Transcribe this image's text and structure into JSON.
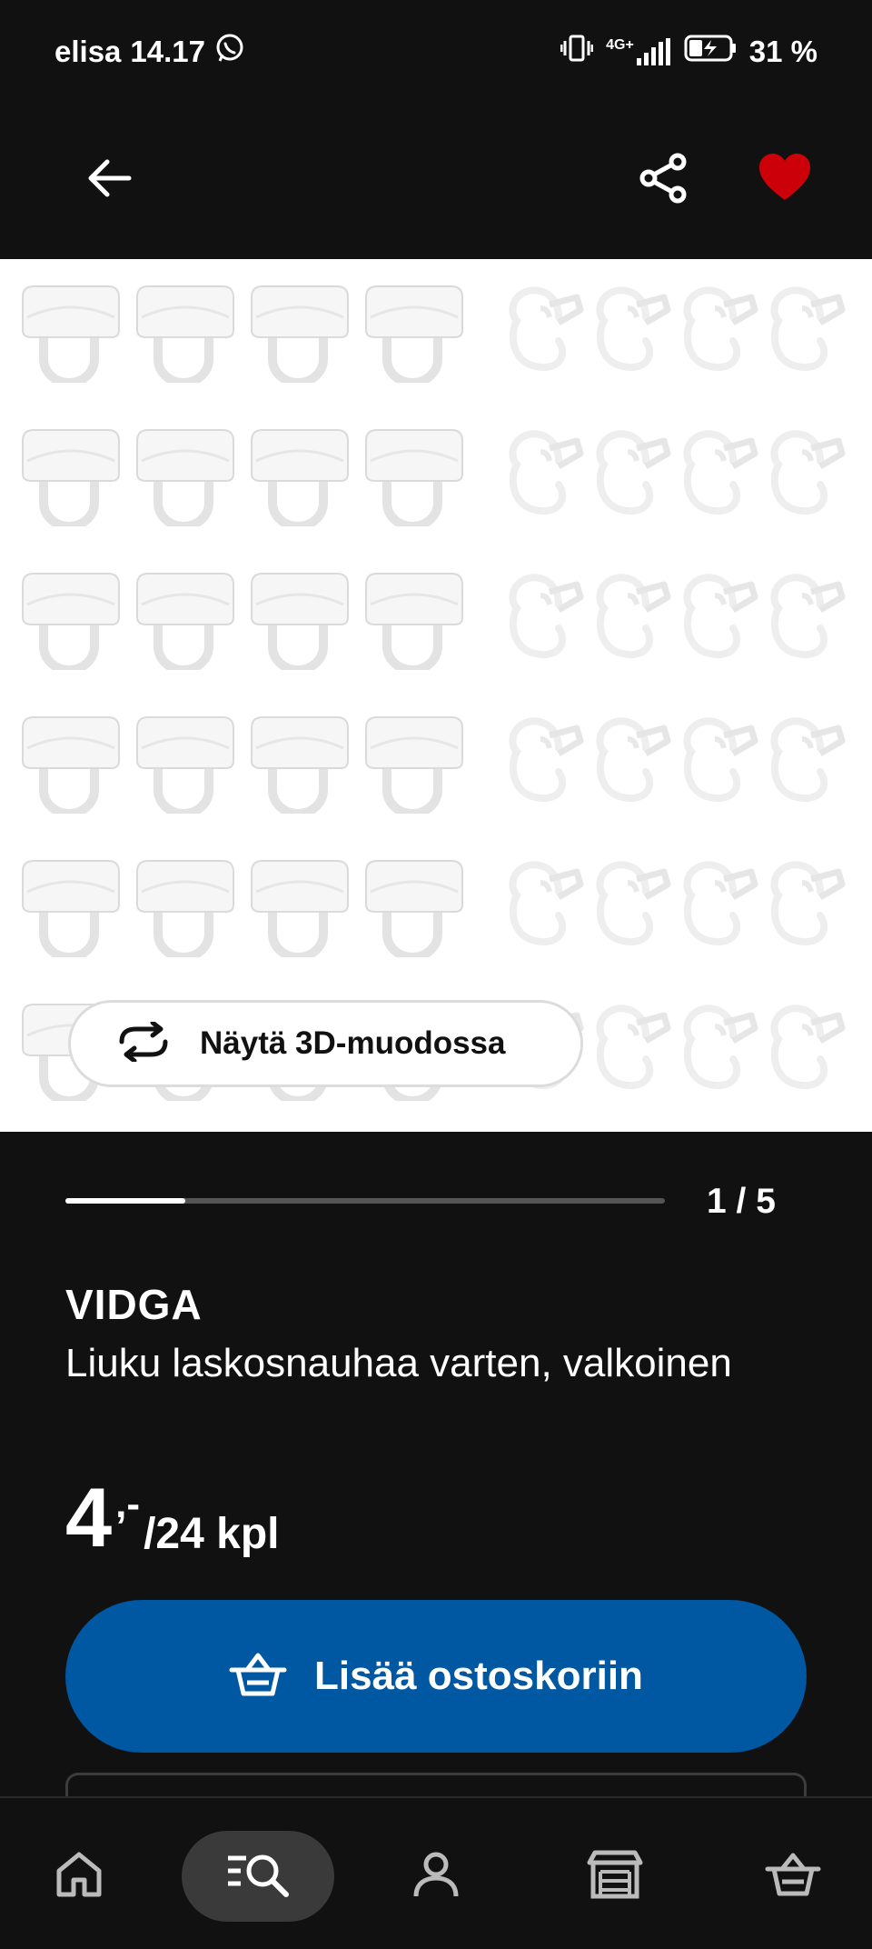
{
  "status_bar": {
    "carrier": "elisa",
    "time": "14.17",
    "network": "4G+",
    "battery": "31 %"
  },
  "header": {
    "favorited": true,
    "accent_color": "#cc0008"
  },
  "gallery": {
    "view_3d_label": "Näytä 3D-muodossa",
    "counter": "1 / 5",
    "current": 1,
    "total": 5
  },
  "product": {
    "name": "VIDGA",
    "description": "Liuku laskosnauhaa varten, valkoinen",
    "price_int": "4",
    "price_dec": ",-",
    "price_unit": "/24 kpl"
  },
  "actions": {
    "add_to_cart_label": "Lisää ostoskoriin",
    "button_color": "#0058a3"
  },
  "bottom_nav": {
    "items": [
      {
        "icon": "home-icon"
      },
      {
        "icon": "search-icon",
        "active": true
      },
      {
        "icon": "profile-icon"
      },
      {
        "icon": "store-icon"
      },
      {
        "icon": "basket-icon"
      }
    ]
  }
}
